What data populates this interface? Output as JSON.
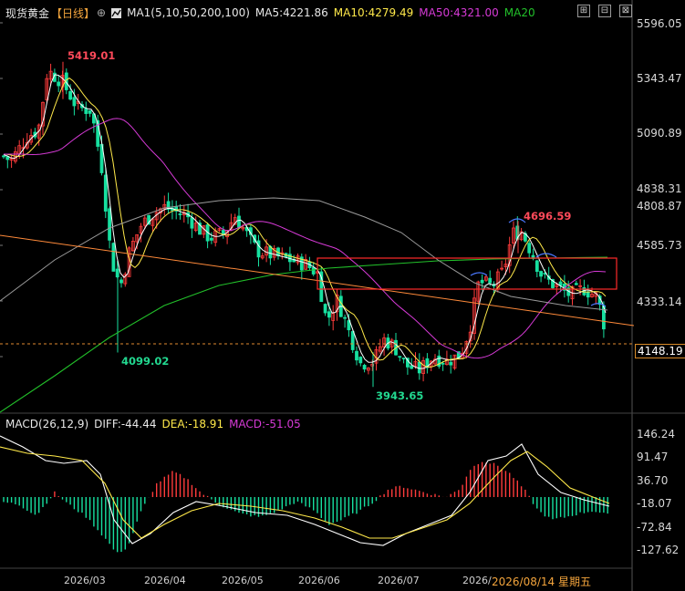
{
  "header": {
    "symbol": "现货黄金",
    "period": "【日线】",
    "plus_icon": "⊕",
    "ma_icon_name": "indicator-icon",
    "ma_set": "MA1(5,10,50,200,100)",
    "ma5": "MA5:4221.86",
    "ma10": "MA10:4279.49",
    "ma50": "MA50:4321.00",
    "ma20": "MA20",
    "window_buttons": [
      "⊞",
      "⊟",
      "⊠"
    ]
  },
  "macd_header": {
    "label": "MACD(26,12,9)",
    "diff": "DIFF:-44.44",
    "dea": "DEA:-18.91",
    "macd": "MACD:-51.05"
  },
  "price_axis": [
    "5596.05",
    "5343.47",
    "5090.89",
    "4838.31",
    "4808.87",
    "4585.73",
    "4333.14",
    "4148.19"
  ],
  "macd_axis": [
    "146.24",
    "91.47",
    "36.70",
    "-18.07",
    "-72.84",
    "-127.62"
  ],
  "time_axis": [
    "2026/03",
    "2026/04",
    "2026/05",
    "2026/06",
    "2026/07",
    "2026/0"
  ],
  "hover_date": "2026/08/14 星期五",
  "annotations": {
    "high": "5419.01",
    "low1": "4099.02",
    "low2": "3943.65",
    "peak2": "4696.59"
  },
  "colors": {
    "up": "#ff3b3b",
    "down": "#17e0a0",
    "ma5": "#ffffff",
    "ma10": "#ffe94a",
    "ma50": "#d63ad6",
    "ma20": "#22c02a",
    "ma200": "#9a9a9a",
    "trend": "#ff8a3a",
    "box": "#ff2a2a"
  }
}
